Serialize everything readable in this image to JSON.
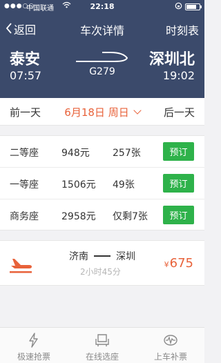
{
  "status_bar": {
    "signal": "●●●○○",
    "carrier": "中国联通",
    "time": "22:18",
    "battery_level": 0.8
  },
  "nav": {
    "back_label": "返回",
    "title": "车次详情",
    "right_label": "时刻表"
  },
  "route": {
    "from_station": "泰安",
    "from_time": "07:57",
    "train_number": "G279",
    "to_station": "深圳北",
    "to_time": "19:02"
  },
  "date_bar": {
    "prev_label": "前一天",
    "date_label": "6月18日 周日",
    "next_label": "后一天"
  },
  "seats": [
    {
      "class": "二等座",
      "price": "948元",
      "remaining": "257张",
      "book_label": "预订"
    },
    {
      "class": "一等座",
      "price": "1506元",
      "remaining": "49张",
      "book_label": "预订"
    },
    {
      "class": "商务座",
      "price": "2958元",
      "remaining": "仅剩7张",
      "book_label": "预订"
    }
  ],
  "flight": {
    "from_city": "济南",
    "to_city": "深圳",
    "duration": "2小时45分",
    "currency": "¥",
    "price": "675"
  },
  "tabs": [
    {
      "label": "极速抢票",
      "icon": "lightning-icon"
    },
    {
      "label": "在线选座",
      "icon": "seat-icon"
    },
    {
      "label": "上车补票",
      "icon": "ticket-icon"
    }
  ],
  "colors": {
    "header_bg": "#3b4a6b",
    "accent_orange": "#e8623a",
    "book_green": "#2eb24a"
  }
}
